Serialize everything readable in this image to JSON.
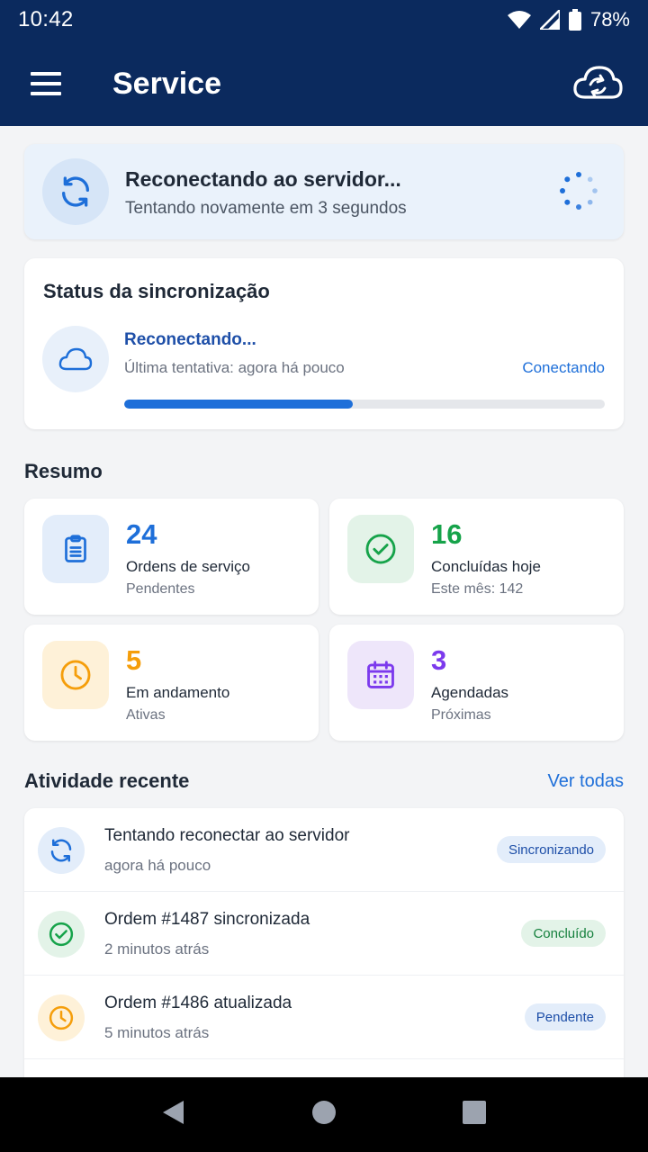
{
  "status_bar": {
    "time": "10:42",
    "battery": "78%"
  },
  "app_bar": {
    "title": "Service"
  },
  "banner": {
    "title": "Reconectando ao servidor...",
    "subtitle": "Tentando novamente em 3 segundos"
  },
  "sync_status": {
    "heading": "Status da sincronização",
    "state": "Reconectando...",
    "last_attempt": "Última tentativa: agora há pouco",
    "status_label": "Conectando",
    "progress": 0.475
  },
  "summary": {
    "heading": "Resumo",
    "cards": [
      {
        "value": "24",
        "label": "Ordens de serviço",
        "sub": "Pendentes",
        "icon": "clipboard-icon",
        "color": "#1E6FD9",
        "bg": "#E3EDFA"
      },
      {
        "value": "16",
        "label": "Concluídas hoje",
        "sub": "Este mês: 142",
        "icon": "check-circle-icon",
        "color": "#16A34A",
        "bg": "#E3F3E8"
      },
      {
        "value": "5",
        "label": "Em andamento",
        "sub": "Ativas",
        "icon": "clock-icon",
        "color": "#F59E0B",
        "bg": "#FEF1D8"
      },
      {
        "value": "3",
        "label": "Agendadas",
        "sub": "Próximas",
        "icon": "calendar-icon",
        "color": "#7C3AED",
        "bg": "#EEE6FA"
      }
    ]
  },
  "activity": {
    "heading": "Atividade recente",
    "see_all": "Ver todas",
    "items": [
      {
        "title": "Tentando reconectar ao servidor",
        "time": "agora há pouco",
        "badge": "Sincronizando",
        "icon": "refresh-icon"
      },
      {
        "title": "Ordem #1487 sincronizada",
        "time": "2 minutos atrás",
        "badge": "Concluído",
        "icon": "check-circle-icon"
      },
      {
        "title": "Ordem #1486 atualizada",
        "time": "5 minutos atrás",
        "badge": "Pendente",
        "icon": "clock-icon"
      }
    ]
  }
}
